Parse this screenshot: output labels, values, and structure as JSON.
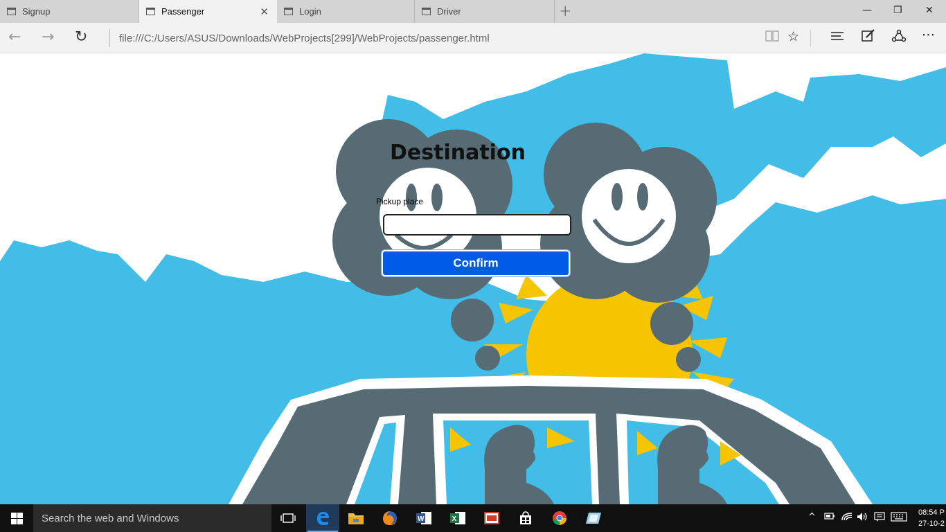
{
  "browser": {
    "tabs": [
      {
        "label": "Signup",
        "active": false
      },
      {
        "label": "Passenger",
        "active": true
      },
      {
        "label": "Login",
        "active": false
      },
      {
        "label": "Driver",
        "active": false
      }
    ],
    "new_tab_glyph": "+",
    "window_controls": {
      "minimize": "—",
      "restore": "❐",
      "close": "✕"
    },
    "url": "file:///C:/Users/ASUS/Downloads/WebProjects[299]/WebProjects/passenger.html",
    "toolbar_icons": [
      "reading-view-icon",
      "favorites-star-icon",
      "hub-icon",
      "web-note-icon",
      "share-icon",
      "more-icon"
    ]
  },
  "page": {
    "title": "Destination",
    "pickup_label": "Pickup place",
    "pickup_value": "",
    "confirm_label": "Confirm",
    "colors": {
      "sky": "#42bde8",
      "cloud": "#566b74",
      "sun": "#f6c500",
      "button": "#005ce6"
    }
  },
  "taskbar": {
    "search_placeholder": "Search the web and Windows",
    "apps": [
      "task-view-icon",
      "edge-icon",
      "file-explorer-icon",
      "firefox-icon",
      "word-icon",
      "excel-icon",
      "acrobat-icon",
      "store-icon",
      "chrome-icon",
      "app-icon"
    ],
    "clock_time": "08:54 P",
    "clock_date": "27-10-2"
  }
}
